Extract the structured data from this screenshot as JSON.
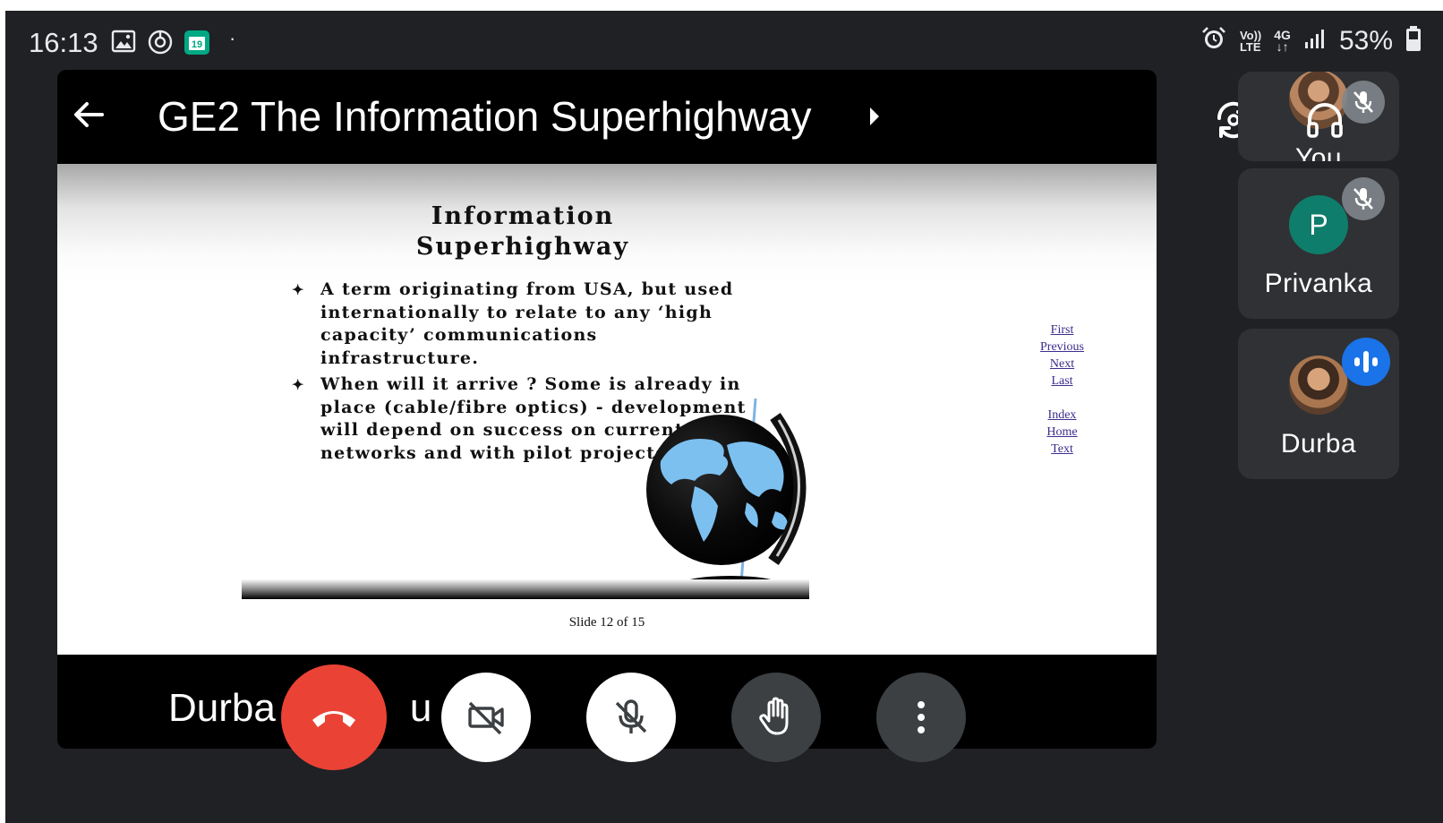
{
  "status_bar": {
    "time": "16:13",
    "calendar_day": "19",
    "dot": "·",
    "network_label_top": "Vo))",
    "network_label_bottom": "LTE",
    "network_type": "4G",
    "battery_percent": "53%",
    "icons": [
      "gallery-icon",
      "circle-clock-icon",
      "calendar-icon",
      "alarm-icon",
      "volte-icon",
      "4g-data-icon",
      "signal-icon",
      "battery-icon"
    ]
  },
  "meeting": {
    "title": "GE2 The Information Superhighway",
    "presenter_name": "Durba",
    "presenter_name_suffix": "u"
  },
  "slide": {
    "title_line1": "Information",
    "title_line2": "Superhighway",
    "bullet_symbol": "✦",
    "bullets": [
      "A term originating from USA, but used internationally to relate to any ‘high capacity’ communications infrastructure.",
      "When will it arrive ? Some is already in place (cable/fibre optics) - development will depend on success on current networks and with pilot projects"
    ],
    "nav_links": [
      "First",
      "Previous",
      "Next",
      "Last",
      "Index",
      "Home",
      "Text"
    ],
    "counter": "Slide 12 of 15",
    "image": "globe-illustration"
  },
  "controls": {
    "end_call": "end-call-icon",
    "camera": "camera-off-icon",
    "microphone": "mic-off-icon",
    "raise_hand": "hand-icon",
    "more": "more-vert-icon"
  },
  "participants": [
    {
      "name": "You",
      "avatar": "photo",
      "muted": true
    },
    {
      "name": "Privanka",
      "initial": "P",
      "avatar_color": "#0f7d6b",
      "muted": true
    },
    {
      "name": "Durba",
      "avatar": "photo",
      "speaking": true
    }
  ],
  "colors": {
    "background": "#202124",
    "end_call": "#ea4335",
    "tile": "#303134",
    "speaking_badge": "#1a73e8",
    "link": "#3d2d8c"
  }
}
